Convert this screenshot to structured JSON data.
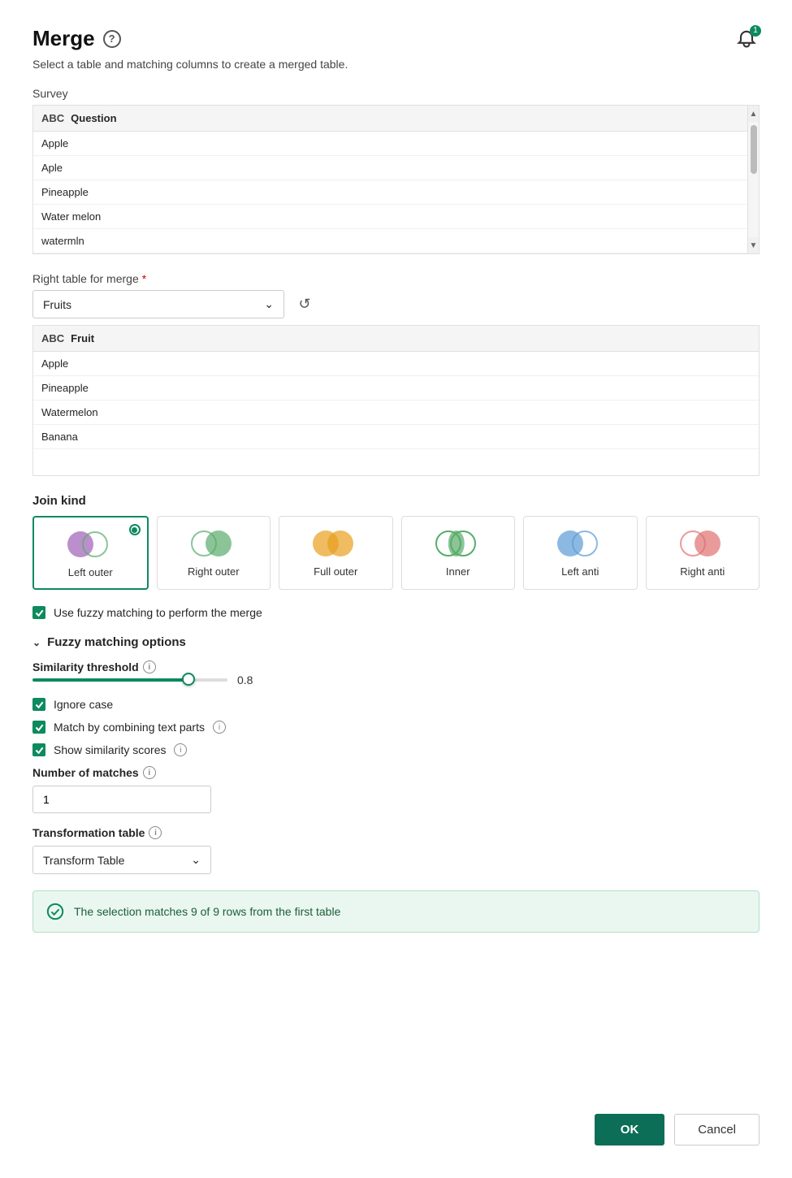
{
  "dialog": {
    "title": "Merge",
    "subtitle": "Select a table and matching columns to create a merged table."
  },
  "help_icon_label": "?",
  "notification_badge": "1",
  "left_table": {
    "label": "Survey",
    "column_header": "Question",
    "rows": [
      "Apple",
      "Aple",
      "Pineapple",
      "Water melon",
      "watermln"
    ]
  },
  "right_table": {
    "label": "Right table for merge",
    "required": true,
    "dropdown_value": "Fruits",
    "column_header": "Fruit",
    "rows": [
      "Apple",
      "Pineapple",
      "Watermelon",
      "Banana"
    ]
  },
  "join_kind": {
    "label": "Join kind",
    "options": [
      {
        "id": "left-outer",
        "label": "Left outer",
        "selected": true
      },
      {
        "id": "right-outer",
        "label": "Right outer",
        "selected": false
      },
      {
        "id": "full-outer",
        "label": "Full outer",
        "selected": false
      },
      {
        "id": "inner",
        "label": "Inner",
        "selected": false
      },
      {
        "id": "left-anti",
        "label": "Left anti",
        "selected": false
      },
      {
        "id": "right-anti",
        "label": "Right anti",
        "selected": false
      }
    ]
  },
  "fuzzy_matching": {
    "checkbox_label": "Use fuzzy matching to perform the merge",
    "checked": true
  },
  "fuzzy_options": {
    "title": "Fuzzy matching options",
    "similarity_threshold": {
      "label": "Similarity threshold",
      "value": 0.8,
      "slider_percent": 80
    },
    "ignore_case": {
      "label": "Ignore case",
      "checked": true
    },
    "match_combining": {
      "label": "Match by combining text parts",
      "checked": true
    },
    "show_scores": {
      "label": "Show similarity scores",
      "checked": true
    },
    "number_of_matches": {
      "label": "Number of matches",
      "value": "1"
    },
    "transformation_table": {
      "label": "Transformation table",
      "value": "Transform Table"
    }
  },
  "success_banner": {
    "text": "The selection matches 9 of 9 rows from the first table"
  },
  "buttons": {
    "ok": "OK",
    "cancel": "Cancel"
  }
}
